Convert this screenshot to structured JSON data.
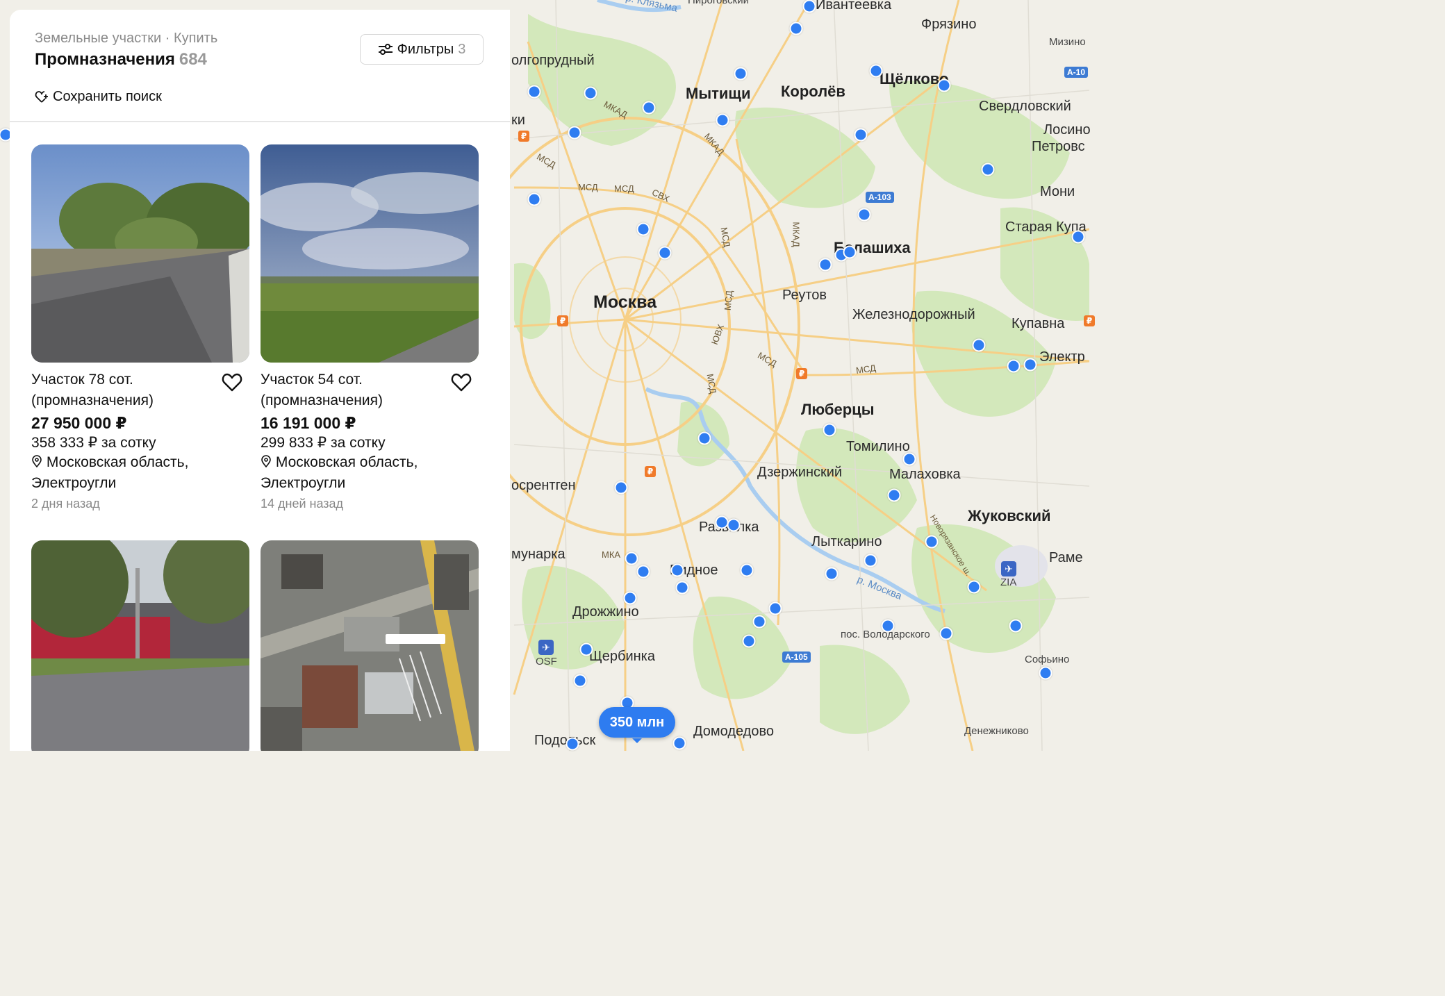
{
  "panel": {
    "breadcrumb": "Земельные участки · Купить",
    "heading_title": "Промназначения",
    "heading_count": "684",
    "filters_label": "Фильтры",
    "filters_count": "3",
    "save_search_label": "Сохранить поиск"
  },
  "listings": [
    {
      "title": "Участок 78 сот. (промназначения)",
      "price": "27 950 000 ₽",
      "price_per_unit": "358 333 ₽ за сотку",
      "location": "Московская область, Электроугли",
      "posted": "2 дня назад",
      "photo": "tree-lined-road"
    },
    {
      "title": "Участок 54 сот. (промназначения)",
      "price": "16 191 000 ₽",
      "price_per_unit": "299 833 ₽ за сотку",
      "location": "Московская область, Электроугли",
      "posted": "14 дней назад",
      "photo": "open-field-cloudy-sky"
    },
    {
      "photo": "street-warehouse"
    },
    {
      "photo": "satellite-view"
    }
  ],
  "map": {
    "price_bubble": "350 млн",
    "cities": {
      "moskva": "Москва",
      "mytishchi": "Мытищи",
      "korolev": "Королёв",
      "shchelkovo": "Щёлково",
      "fryazino": "Фрязино",
      "ivanteevka": "Ивантеевка",
      "dolgoprudny": "олгопрудный",
      "sverdlovsky": "Свердловский",
      "losino": "Лосино",
      "petrovsk": "Петровс",
      "moni": "Мони",
      "staraya": "Старая Купа",
      "balashikha": "Балашиха",
      "reutov": "Реутов",
      "zheleznodorozhny": "Железнодорожный",
      "kupavna": "Купавна",
      "elektr": "Электр",
      "lyubertsy": "Люберцы",
      "tomilino": "Томилино",
      "malakhovka": "Малаховка",
      "dzerzhinsky": "Дзержинский",
      "rentgen": "осрентген",
      "razvilka": "Развилка",
      "zhukovsky": "Жуковский",
      "lytkarino": "Лыткарино",
      "ramen": "Раме",
      "kommunarka": "мунарка",
      "vidnoe": "Видное",
      "drozhzhino": "Дрожжино",
      "shcherbinka": "Щербинка",
      "volodarsky": "пос. Володарского",
      "sofyino": "Софьино",
      "domodedovo": "Домодедово",
      "podolsk": "Подольск",
      "denezhnikovo": "Денежниково",
      "mizino": "Мизино",
      "pirogovsky": "Пироговский",
      "klyazma": "р. Клязьма",
      "moskva_river": "р. Москва",
      "ki": "ки"
    },
    "road_labels": {
      "mkad1": "МКАД",
      "mkad2": "МКАД",
      "mkad3": "МКАД",
      "mkad4": "МКА",
      "msd1": "МСД",
      "msd2": "МСД",
      "msd3": "МСД",
      "msd4": "МСД",
      "msd5": "МСД",
      "msd6": "МСД",
      "msd7": "МСД",
      "msd8": "МСД",
      "svkh": "СВХ",
      "yuvkh": "ЮВХ",
      "novoryaz": "Новорязанское ш."
    },
    "shields": {
      "a103": "А-103",
      "a105": "А-105",
      "a10": "А-10"
    },
    "airports": {
      "zia": "ZIA",
      "osf": "OSF"
    }
  },
  "colors": {
    "accent": "#2e7cf0",
    "pin": "#2f7df1",
    "map_bg": "#f1efe8",
    "park": "#cfe6b6",
    "road_major": "#f5c97b",
    "water": "#a9cdf0"
  }
}
